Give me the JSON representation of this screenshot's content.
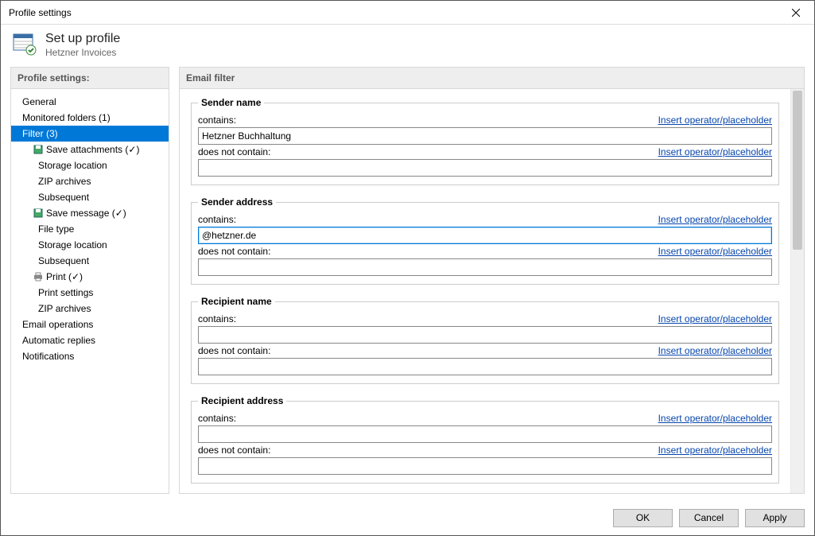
{
  "window": {
    "title": "Profile settings"
  },
  "header": {
    "title": "Set up profile",
    "subtitle": "Hetzner Invoices"
  },
  "sidebar": {
    "heading": "Profile settings:",
    "items": [
      {
        "label": "General"
      },
      {
        "label": "Monitored folders (1)"
      },
      {
        "label": "Filter (3)",
        "selected": true
      },
      {
        "label": "Save attachments (✓)",
        "icon": "save"
      },
      {
        "label": "Storage location"
      },
      {
        "label": "ZIP archives"
      },
      {
        "label": "Subsequent"
      },
      {
        "label": "Save message (✓)",
        "icon": "save"
      },
      {
        "label": "File type"
      },
      {
        "label": "Storage location"
      },
      {
        "label": "Subsequent"
      },
      {
        "label": "Print  (✓)",
        "icon": "print"
      },
      {
        "label": "Print settings"
      },
      {
        "label": "ZIP archives"
      },
      {
        "label": "Email operations"
      },
      {
        "label": "Automatic replies"
      },
      {
        "label": "Notifications"
      }
    ]
  },
  "main": {
    "heading": "Email filter",
    "op_link": "Insert operator/placeholder",
    "labels": {
      "contains": "contains:",
      "notcontains": "does not contain:"
    },
    "groups": [
      {
        "legend": "Sender name",
        "contains": "Hetzner Buchhaltung",
        "notcontains": ""
      },
      {
        "legend": "Sender address",
        "contains": "@hetzner.de",
        "notcontains": "",
        "focus": true
      },
      {
        "legend": "Recipient name",
        "contains": "",
        "notcontains": ""
      },
      {
        "legend": "Recipient address",
        "contains": "",
        "notcontains": ""
      }
    ]
  },
  "footer": {
    "ok": "OK",
    "cancel": "Cancel",
    "apply": "Apply"
  }
}
